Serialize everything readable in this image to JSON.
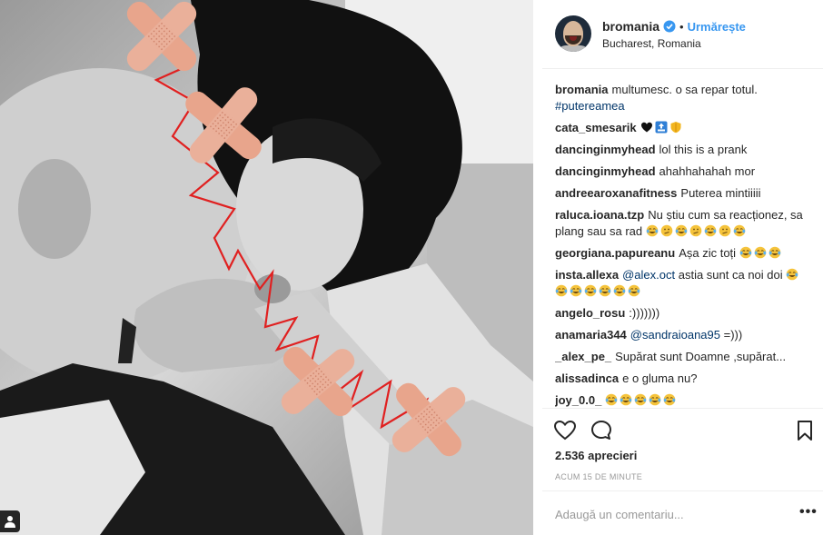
{
  "post": {
    "username": "bromania",
    "follow_label": "Urmărește",
    "separator": "•",
    "location": "Bucharest, Romania",
    "verified_icon": "verified-badge-icon"
  },
  "caption": {
    "username": "bromania",
    "text": "multumesc. o sa repar totul.",
    "hashtag": "#putereamea"
  },
  "comments": [
    {
      "user": "cata_smesarik",
      "text": "",
      "emojis": [
        "black-heart",
        "top-arrow",
        "shield"
      ]
    },
    {
      "user": "dancinginmyhead",
      "text": "lol this is a prank",
      "emojis": []
    },
    {
      "user": "dancinginmyhead",
      "text": "ahahhahahah mor",
      "emojis": []
    },
    {
      "user": "andreearoxanafitness",
      "text": "Puterea mintiiiii",
      "emojis": []
    },
    {
      "user": "raluca.ioana.tzp",
      "text": "Nu știu cum sa reacționez, sa plang sau sa rad",
      "emojis": [
        "tears-of-joy",
        "confused",
        "tears-of-joy",
        "confused",
        "tears-of-joy",
        "confused",
        "tears-of-joy"
      ]
    },
    {
      "user": "georgiana.papureanu",
      "text": "Așa zic toți",
      "emojis": [
        "tears-of-joy",
        "tears-of-joy",
        "tears-of-joy"
      ]
    },
    {
      "user": "insta.allexa",
      "mention": "@alex.oct",
      "text": "astia sunt ca noi doi",
      "emojis": [
        "tears-of-joy",
        "tears-of-joy",
        "tears-of-joy",
        "tears-of-joy",
        "tears-of-joy",
        "tears-of-joy",
        "tears-of-joy"
      ]
    },
    {
      "user": "angelo_rosu",
      "text": ":)))))))",
      "emojis": []
    },
    {
      "user": "anamaria344",
      "mention": "@sandraioana95",
      "text": "=)))",
      "emojis": []
    },
    {
      "user": "_alex_pe_",
      "text": "Supărat sunt Doamne ,supărat...",
      "emojis": []
    },
    {
      "user": "alissadinca",
      "text": "e o gluma nu?",
      "emojis": []
    },
    {
      "user": "joy_0.0_",
      "text": "",
      "emojis": [
        "tears-of-joy",
        "tears-of-joy",
        "tears-of-joy",
        "tears-of-joy",
        "tears-of-joy"
      ]
    }
  ],
  "actions": {
    "like_icon": "heart-icon",
    "comment_icon": "comment-bubble-icon",
    "save_icon": "bookmark-icon"
  },
  "likes_text": "2.536 aprecieri",
  "timestamp": "ACUM 15 DE MINUTE",
  "add_comment": {
    "placeholder": "Adaugă un comentariu...",
    "more_label": "•••"
  },
  "colors": {
    "accent": "#3897f0",
    "link": "#003569",
    "text": "#262626",
    "muted": "#999999",
    "bandage": "#e8a58c",
    "zigzag": "#e02020"
  }
}
